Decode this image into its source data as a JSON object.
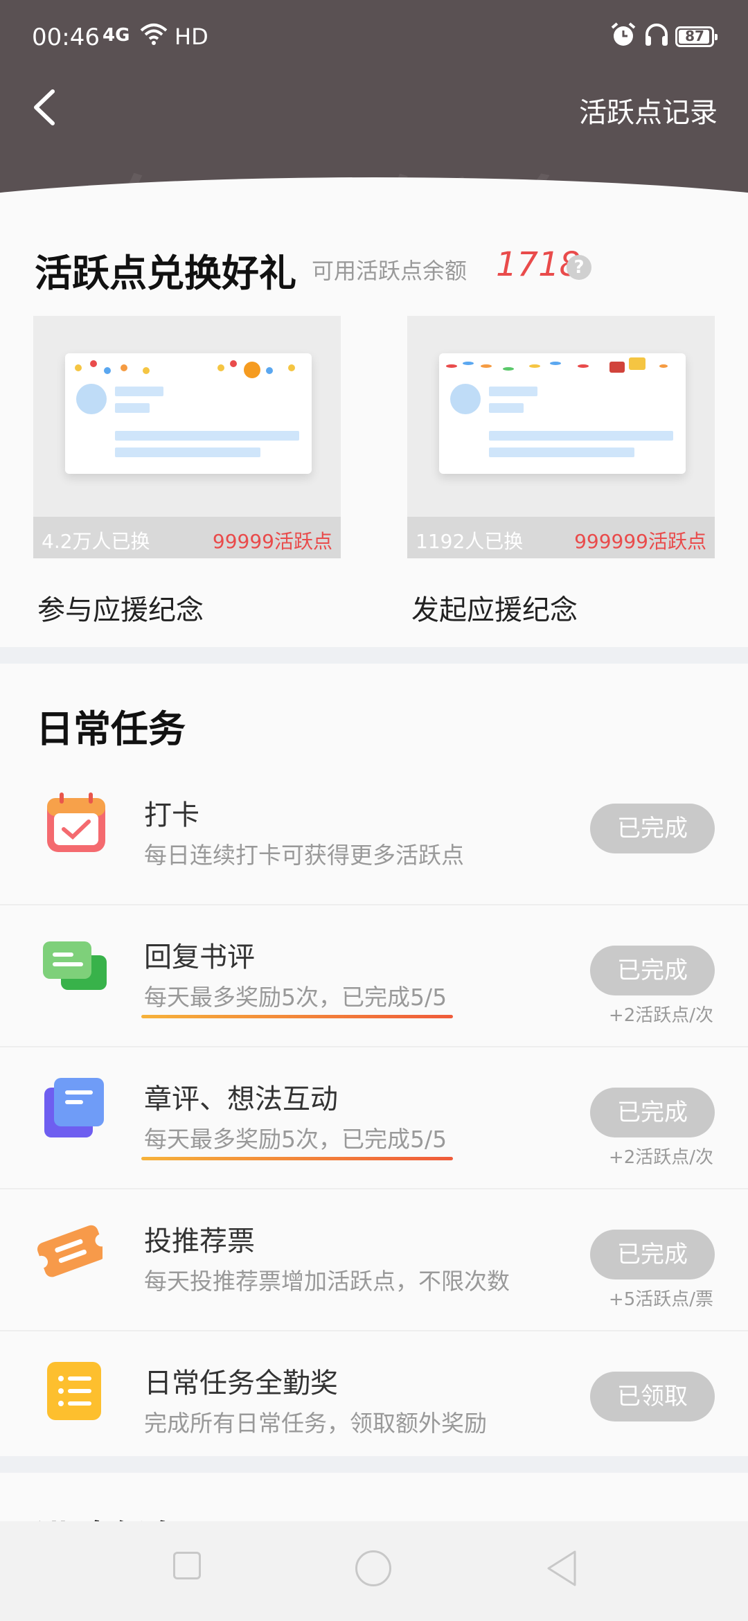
{
  "status_bar": {
    "time": "00:46",
    "network": "4G",
    "hd": "HD",
    "battery": "87"
  },
  "header": {
    "bg_text": "每日任务",
    "right_link": "活跃点记录"
  },
  "exchange": {
    "title": "活跃点兑换好礼",
    "balance_label": "可用活跃点余额",
    "balance_value": "1718",
    "help": "?",
    "gifts": [
      {
        "name": "参与应援纪念",
        "count": "4.2万人已换",
        "price": "99999活跃点"
      },
      {
        "name": "发起应援纪念",
        "count": "1192人已换",
        "price": "999999活跃点"
      }
    ]
  },
  "daily": {
    "title": "日常任务",
    "tasks": [
      {
        "icon": "calendar-icon",
        "title": "打卡",
        "desc": "每日连续打卡可获得更多活跃点",
        "button": "已完成",
        "bonus": ""
      },
      {
        "icon": "chat-icon",
        "title": "回复书评",
        "desc": "每天最多奖励5次，已完成5/5",
        "button": "已完成",
        "bonus": "+2活跃点/次"
      },
      {
        "icon": "document-icon",
        "title": "章评、想法互动",
        "desc": "每天最多奖励5次，已完成5/5",
        "button": "已完成",
        "bonus": "+2活跃点/次"
      },
      {
        "icon": "ticket-icon",
        "title": "投推荐票",
        "desc": "每天投推荐票增加活跃点，不限次数",
        "button": "已完成",
        "bonus": "+5活跃点/票"
      },
      {
        "icon": "list-icon",
        "title": "日常任务全勤奖",
        "desc": "完成所有日常任务，领取额外奖励",
        "button": "已领取",
        "bonus": ""
      }
    ]
  },
  "advanced": {
    "title": "进阶任务"
  },
  "colors": {
    "header_bg": "#5a5153",
    "accent_red": "#e94b4b",
    "button_gray": "#c9c9c9"
  }
}
